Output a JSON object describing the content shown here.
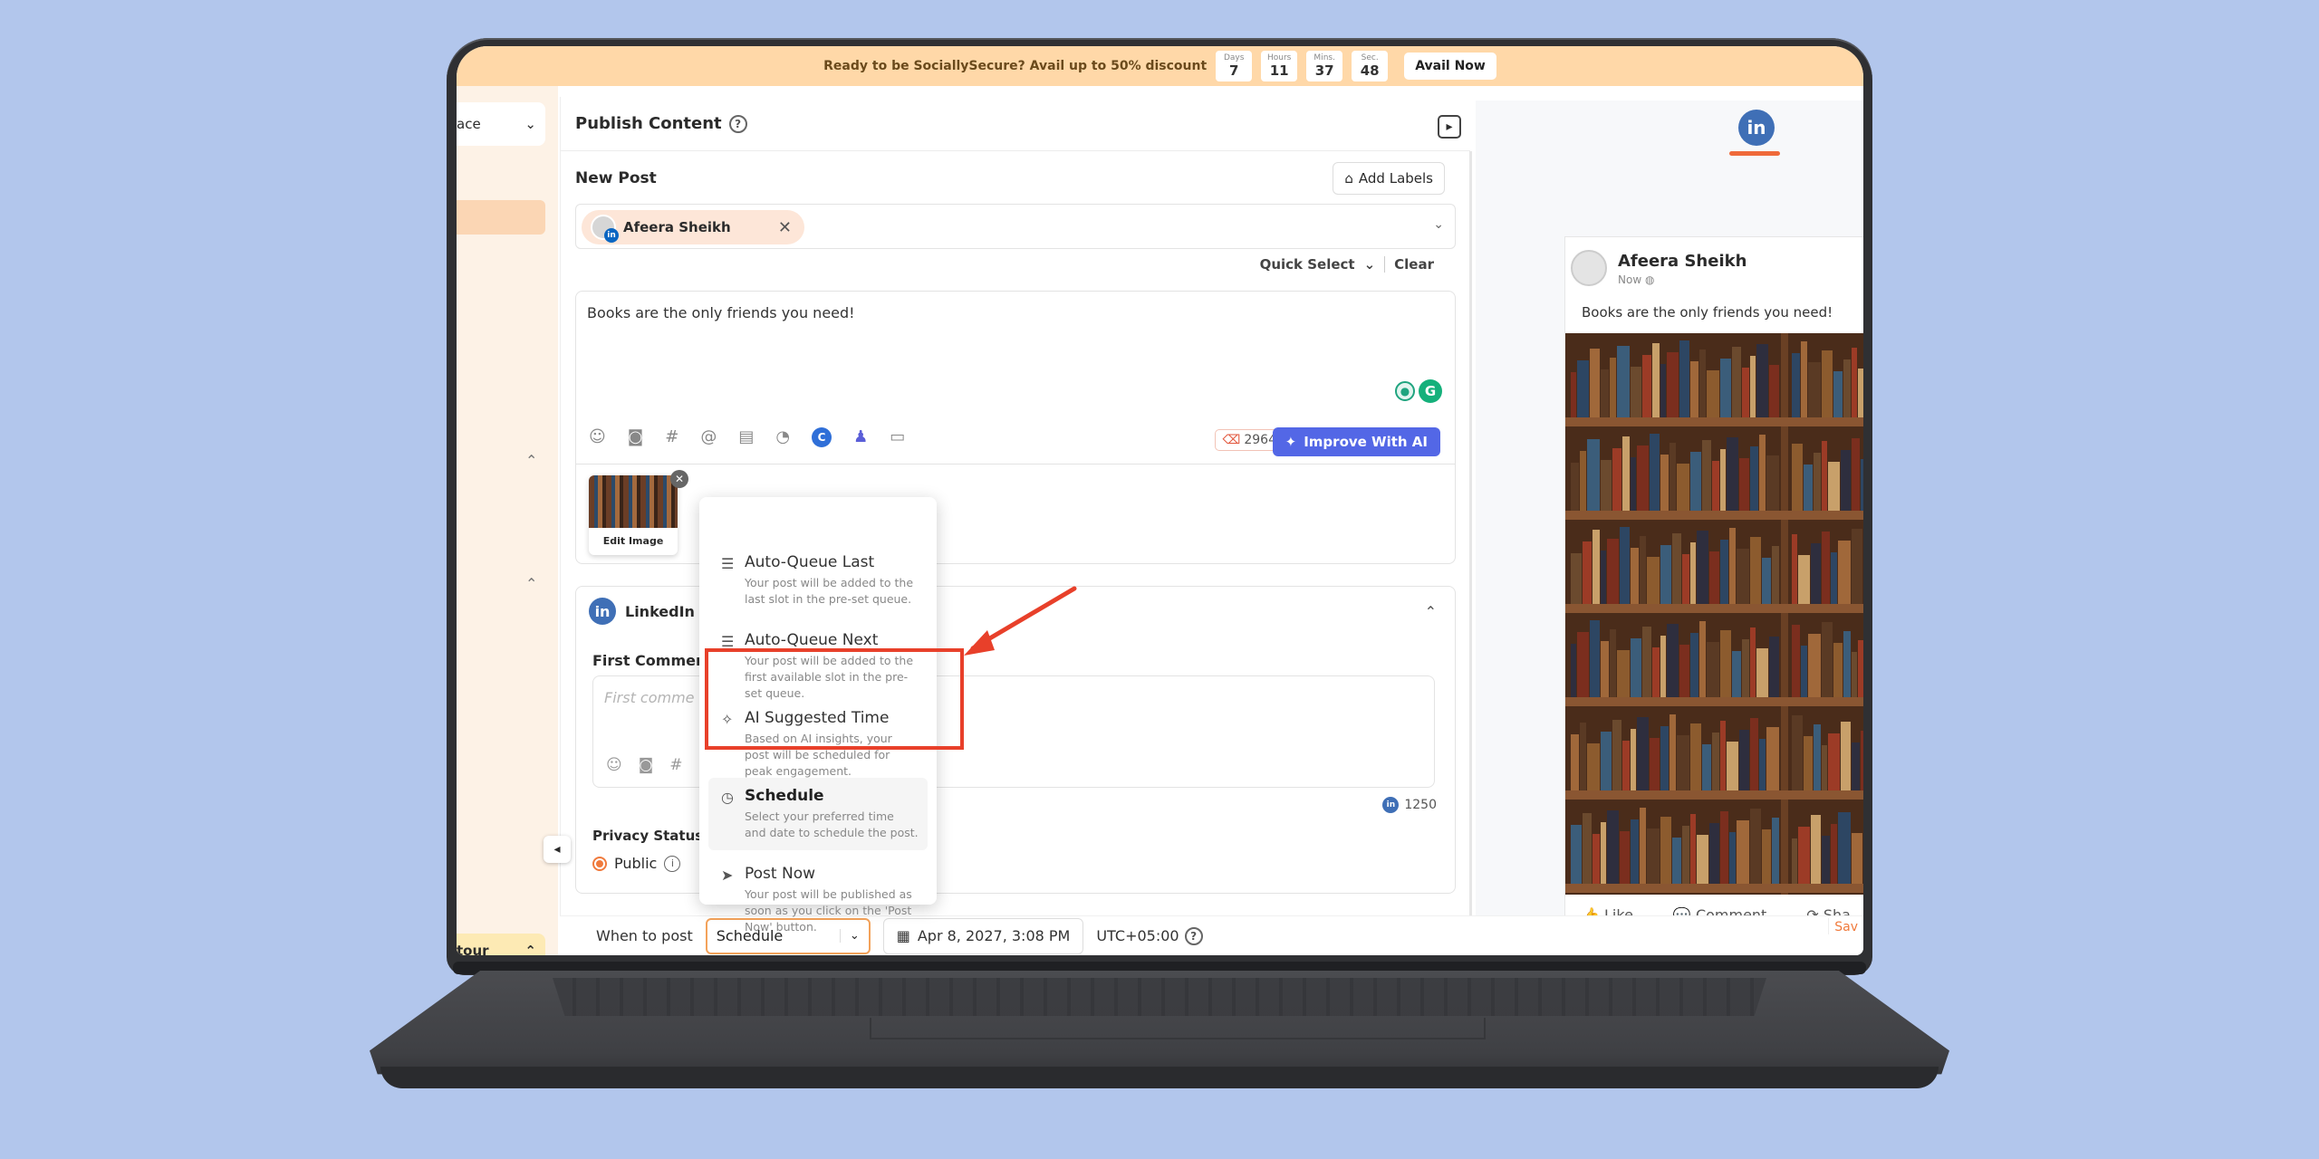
{
  "promo": {
    "message": "Ready to be SociallySecure? Avail up to 50% discount",
    "countdown": [
      {
        "unit": "Days",
        "value": "7"
      },
      {
        "unit": "Hours",
        "value": "11"
      },
      {
        "unit": "Mins.",
        "value": "37"
      },
      {
        "unit": "Sec.",
        "value": "48"
      }
    ],
    "cta": "Avail Now"
  },
  "sidebar": {
    "workspace": "ace",
    "tour": "tour"
  },
  "publish": {
    "title": "Publish Content",
    "help_icon": "?",
    "new_post": "New Post",
    "add_labels": "Add Labels",
    "account_chip": "Afeera Sheikh",
    "quick_select": "Quick Select",
    "clear": "Clear",
    "post_text": "Books are the only friends you need!",
    "char_count": "2964",
    "improve_ai": "Improve With AI",
    "edit_image": "Edit Image"
  },
  "linkedin_section": {
    "title": "LinkedIn C",
    "first_comment_label": "First Comment",
    "first_comment_placeholder": "First comme",
    "count": "1250",
    "privacy_title": "Privacy Status",
    "privacy_value": "Public"
  },
  "menu": {
    "items": [
      {
        "title": "Auto-Queue Last",
        "desc": "Your post will be added to the last slot in the pre-set queue."
      },
      {
        "title": "Auto-Queue Next",
        "desc": "Your post will be added to the first available slot in the pre-set queue."
      },
      {
        "title": "AI Suggested Time",
        "desc": "Based on AI insights, your post will be scheduled for peak engagement."
      },
      {
        "title": "Schedule",
        "desc": "Select your preferred time and date to schedule the post."
      },
      {
        "title": "Post Now",
        "desc": "Your post will be published as soon as you click on the 'Post Now' button."
      }
    ]
  },
  "footer": {
    "when_label": "When to post",
    "selected": "Schedule",
    "date": "Apr 8, 2027, 3:08 PM",
    "timezone": "UTC+05:00",
    "save_fragment": "Sav"
  },
  "preview": {
    "name": "Afeera Sheikh",
    "time": "Now",
    "text": "Books are the only friends you need!",
    "actions": [
      "Like",
      "Comment",
      "Sha"
    ]
  },
  "colors": {
    "background": "#b2c6ec",
    "promo": "#ffd8a8",
    "accent": "#f07a3c",
    "ai_button": "#5367e6",
    "linkedin": "#3f6fb6",
    "highlight": "#e8402a"
  }
}
